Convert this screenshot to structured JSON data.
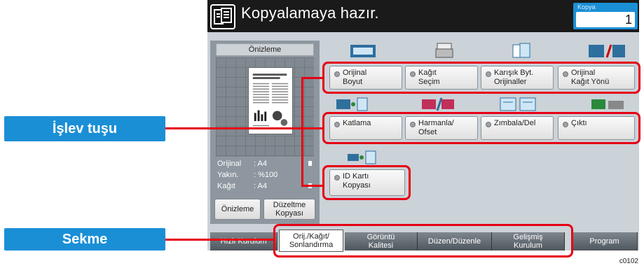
{
  "header": {
    "status": "Kopyalamaya hazır.",
    "copy_label": "Kopya",
    "copy_count": "1"
  },
  "preview": {
    "title": "Önizleme",
    "original_label": "Orijinal",
    "original_value": ": A4",
    "zoom_label": "Yakın.",
    "zoom_value": ": %100",
    "paper_label": "Kağıt",
    "paper_value": ": A4",
    "preview_button": "Önizleme",
    "edit_copy_button": "Düzeltme\nKopyası"
  },
  "function_keys": {
    "row1": [
      {
        "label": "Orijinal\nBoyut"
      },
      {
        "label": "Kağıt\nSeçim"
      },
      {
        "label": "Karışık Byt.\nOrijinaller"
      },
      {
        "label": "Orijinal\nKağıt Yönü"
      }
    ],
    "row2": [
      {
        "label": "Katlama"
      },
      {
        "label": "Harmanla/\nOfset"
      },
      {
        "label": "Zımbala/Del"
      },
      {
        "label": "Çıktı"
      }
    ],
    "row3": [
      {
        "label": "ID Kartı\nKopyası"
      }
    ]
  },
  "tabs": [
    {
      "label": "Hızlı Kurulum"
    },
    {
      "label": "Orij./Kağıt/\nSonlandırma"
    },
    {
      "label": "Görüntü\nKalitesi"
    },
    {
      "label": "Düzen/Düzenle"
    },
    {
      "label": "Gelişmiş\nKurulum"
    },
    {
      "label": "Program"
    }
  ],
  "annotations": {
    "function_key_label": "İşlev tuşu",
    "tab_label": "Sekme",
    "figure_code": "c0102"
  },
  "colors": {
    "accent_blue": "#1b8fd6",
    "annotation_red": "#e60012",
    "header_bg": "#1a1a1a"
  }
}
